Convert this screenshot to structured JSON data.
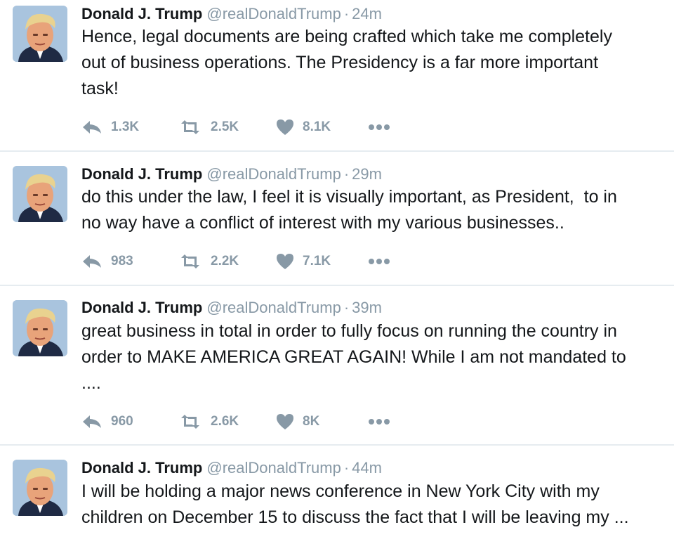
{
  "tweets": [
    {
      "name": "Donald J. Trump",
      "handle": "@realDonaldTrump",
      "separator": "·",
      "time": "24m",
      "text": "Hence, legal documents are being crafted which take me completely\nout of business operations. The Presidency is a far more important\ntask!",
      "replies": "1.3K",
      "retweets": "2.5K",
      "likes": "8.1K"
    },
    {
      "name": "Donald J. Trump",
      "handle": "@realDonaldTrump",
      "separator": "·",
      "time": "29m",
      "text": "do this under the law, I feel it is visually important, as President,  to in\nno way have a conflict of interest with my various businesses..",
      "replies": "983",
      "retweets": "2.2K",
      "likes": "7.1K"
    },
    {
      "name": "Donald J. Trump",
      "handle": "@realDonaldTrump",
      "separator": "·",
      "time": "39m",
      "text": "great business in total in order to fully focus on running the country in\norder to MAKE AMERICA GREAT AGAIN! While I am not mandated to\n....",
      "replies": "960",
      "retweets": "2.6K",
      "likes": "8K"
    },
    {
      "name": "Donald J. Trump",
      "handle": "@realDonaldTrump",
      "separator": "·",
      "time": "44m",
      "text": "I will be holding a major news conference in New York City with my\nchildren on December 15 to discuss the fact that I will be leaving my ...",
      "replies": "",
      "retweets": "",
      "likes": ""
    }
  ],
  "icons": {
    "reply": "reply-icon",
    "retweet": "retweet-icon",
    "like": "heart-icon",
    "more": "more-icon"
  },
  "colors": {
    "text": "#14171a",
    "muted": "#8899a6",
    "divider": "#e6ecf0"
  }
}
